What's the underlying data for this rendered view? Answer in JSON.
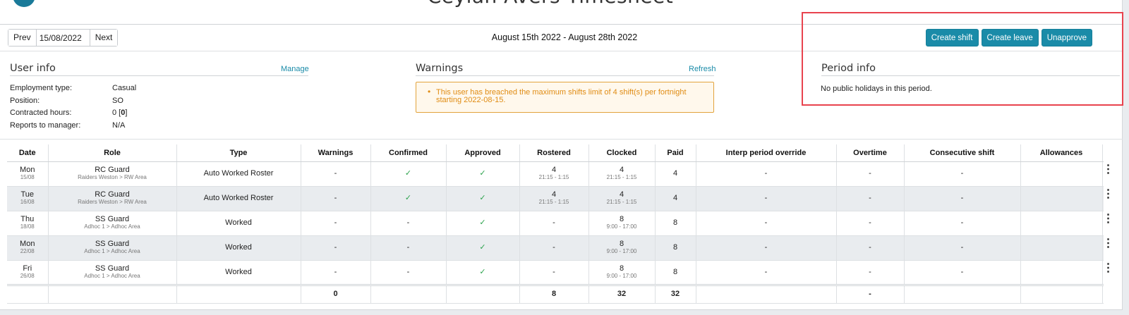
{
  "header": {
    "title": "Ceylan Avers Timesheet"
  },
  "pager": {
    "prev_label": "Prev",
    "date_value": "15/08/2022",
    "next_label": "Next"
  },
  "period_label": "August 15th 2022 - August 28th 2022",
  "actions": {
    "create_shift": "Create shift",
    "create_leave": "Create leave",
    "unapprove": "Unapprove"
  },
  "user_info": {
    "title": "User info",
    "manage_label": "Manage",
    "employment_type_key": "Employment type:",
    "employment_type_val": "Casual",
    "position_key": "Position:",
    "position_val": "SO",
    "contracted_key": "Contracted hours:",
    "contracted_val": "0",
    "contracted_bracket": "0",
    "reports_key": "Reports to manager:",
    "reports_val": "N/A"
  },
  "warnings": {
    "title": "Warnings",
    "refresh_label": "Refresh",
    "message_line1": "This user has breached the maximum shifts limit of 4 shift(s) per fortnight",
    "message_line2": "starting 2022-08-15."
  },
  "period_info": {
    "title": "Period info",
    "text": "No public holidays in this period."
  },
  "table": {
    "headers": [
      "Date",
      "Role",
      "Type",
      "Warnings",
      "Confirmed",
      "Approved",
      "Rostered",
      "Clocked",
      "Paid",
      "Interp period override",
      "Overtime",
      "Consecutive shift",
      "Allowances"
    ],
    "rows": [
      {
        "day": "Mon",
        "date": "15/08",
        "role": "RC Guard",
        "area": "Raiders Weston > RW Area",
        "type": "Auto Worked Roster",
        "warnings": "-",
        "confirmed": "✓",
        "approved": "✓",
        "rostered": "4",
        "rostered_time": "21:15 - 1:15",
        "clocked": "4",
        "clocked_time": "21:15 - 1:15",
        "paid": "4",
        "interp": "-",
        "overtime": "-",
        "consecutive": "-",
        "allowances": ""
      },
      {
        "day": "Tue",
        "date": "16/08",
        "role": "RC Guard",
        "area": "Raiders Weston > RW Area",
        "type": "Auto Worked Roster",
        "warnings": "-",
        "confirmed": "✓",
        "approved": "✓",
        "rostered": "4",
        "rostered_time": "21:15 - 1:15",
        "clocked": "4",
        "clocked_time": "21:15 - 1:15",
        "paid": "4",
        "interp": "-",
        "overtime": "-",
        "consecutive": "-",
        "allowances": ""
      },
      {
        "day": "Thu",
        "date": "18/08",
        "role": "SS Guard",
        "area": "Adhoc 1 > Adhoc Area",
        "type": "Worked",
        "warnings": "-",
        "confirmed": "-",
        "approved": "✓",
        "rostered": "-",
        "rostered_time": "",
        "clocked": "8",
        "clocked_time": "9:00 - 17:00",
        "paid": "8",
        "interp": "-",
        "overtime": "-",
        "consecutive": "-",
        "allowances": ""
      },
      {
        "day": "Mon",
        "date": "22/08",
        "role": "SS Guard",
        "area": "Adhoc 1 > Adhoc Area",
        "type": "Worked",
        "warnings": "-",
        "confirmed": "-",
        "approved": "✓",
        "rostered": "-",
        "rostered_time": "",
        "clocked": "8",
        "clocked_time": "9:00 - 17:00",
        "paid": "8",
        "interp": "-",
        "overtime": "-",
        "consecutive": "-",
        "allowances": ""
      },
      {
        "day": "Fri",
        "date": "26/08",
        "role": "SS Guard",
        "area": "Adhoc 1 > Adhoc Area",
        "type": "Worked",
        "warnings": "-",
        "confirmed": "-",
        "approved": "✓",
        "rostered": "-",
        "rostered_time": "",
        "clocked": "8",
        "clocked_time": "9:00 - 17:00",
        "paid": "8",
        "interp": "-",
        "overtime": "-",
        "consecutive": "-",
        "allowances": ""
      }
    ],
    "totals": {
      "warnings": "0",
      "rostered": "8",
      "clocked": "32",
      "paid": "32",
      "overtime": "-"
    }
  },
  "icons": {
    "row_menu": "vertical-ellipsis-icon",
    "checkmark": "checkmark-icon"
  },
  "colors": {
    "accent": "#1a8ba8",
    "warning": "#e08c14",
    "check": "#2ba24c",
    "highlight_box": "#e8434e"
  }
}
